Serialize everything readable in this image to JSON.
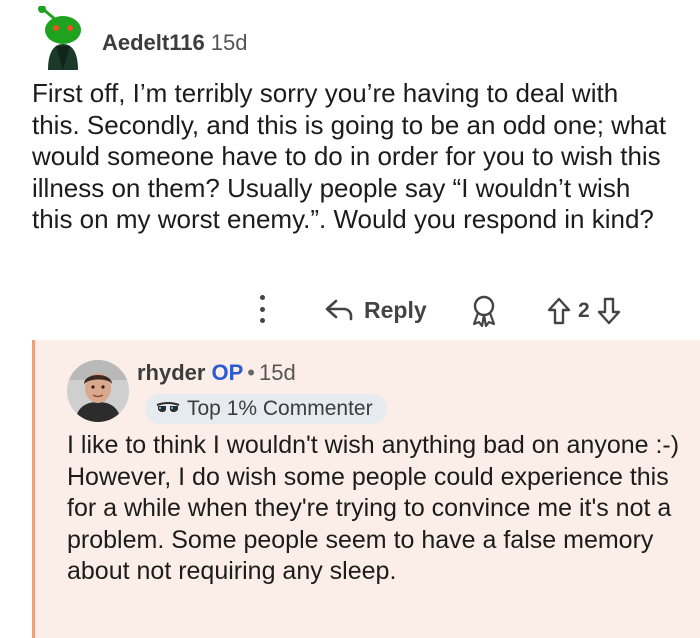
{
  "top_comment": {
    "username": "Aedelt116",
    "age": "15d",
    "body": "First off, I’m terribly sorry you’re having to deal with this. Secondly, and this is going to be an odd one; what would someone have to do in order for you to wish this illness on them? Usually people say “I wouldn’t wish this on my worst enemy.”. Would you respond in kind?",
    "actions": {
      "reply_label": "Reply",
      "vote_count": "2"
    }
  },
  "reply_comment": {
    "username": "rhyder",
    "op_label": "OP",
    "separator": "•",
    "age": "15d",
    "flair": "Top 1% Commenter",
    "body": "I like to think I wouldn't wish anything bad on anyone :-) However, I do wish some people could experience this for a while when they're trying to convince me it's not a problem. Some people seem to have a false memory about not requiring any sleep."
  },
  "colors": {
    "reply_background": "#fbeee8",
    "reply_border": "#e9a27c",
    "op_blue": "#2a5bd7",
    "flair_background": "#e5ebee",
    "snoo_green": "#1fa21f"
  },
  "icons": [
    "snoo-avatar-icon",
    "more-options-icon",
    "reply-arrow-icon",
    "award-icon",
    "upvote-icon",
    "downvote-icon",
    "sunglasses-icon",
    "user-photo-avatar"
  ]
}
